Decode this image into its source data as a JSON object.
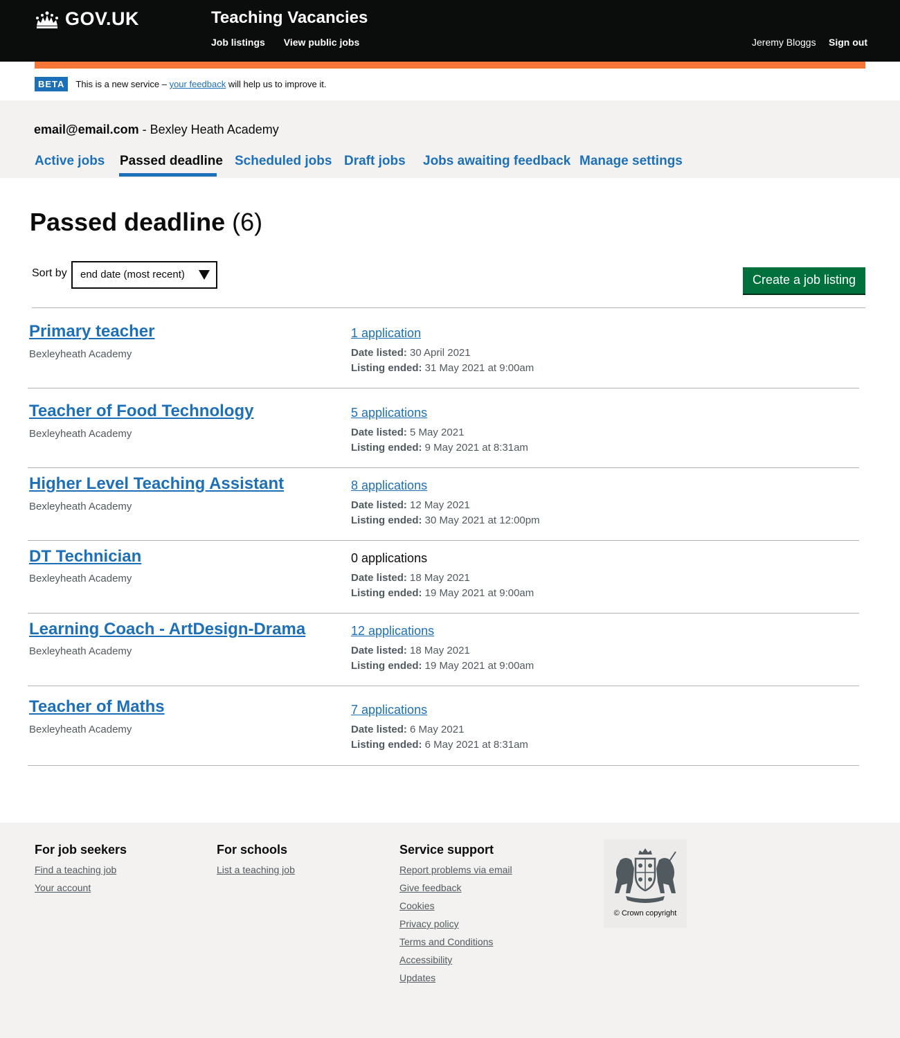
{
  "header": {
    "logo_text": "GOV.UK",
    "service_name": "Teaching Vacancies",
    "nav": [
      "Job listings",
      "View public jobs"
    ],
    "user_name": "Jeremy Bloggs",
    "sign_out": "Sign out"
  },
  "beta": {
    "tag": "BETA",
    "text_before": "This is a new service –",
    "link": "your feedback",
    "text_after": "will help us to improve it."
  },
  "account": {
    "email": "email@email.com",
    "school": "- Bexley Heath Academy"
  },
  "tabs": [
    {
      "label": "Active jobs",
      "active": false
    },
    {
      "label": "Passed deadline",
      "active": true
    },
    {
      "label": "Scheduled jobs",
      "active": false
    },
    {
      "label": "Draft jobs",
      "active": false
    },
    {
      "label": "Jobs awaiting feedback",
      "active": false
    },
    {
      "label": "Manage settings",
      "active": false
    }
  ],
  "page": {
    "title": "Passed deadline",
    "count": "(6)",
    "sort_label": "Sort by",
    "sort_value": "end date (most recent)",
    "create_button": "Create a job listing"
  },
  "jobs": [
    {
      "title": "Primary teacher",
      "school": "Bexleyheath Academy",
      "applications": "1 application",
      "applications_link": true,
      "date_listed_label": "Date listed:",
      "date_listed": "30 April 2021",
      "listing_ended_label": "Listing ended:",
      "listing_ended": "31 May 2021 at 9:00am"
    },
    {
      "title": "Teacher of Food Technology",
      "school": "Bexleyheath Academy",
      "applications": "5 applications",
      "applications_link": true,
      "date_listed_label": "Date listed:",
      "date_listed": "5 May 2021",
      "listing_ended_label": "Listing ended:",
      "listing_ended": "9 May 2021 at 8:31am"
    },
    {
      "title": "Higher Level Teaching Assistant",
      "school": "Bexleyheath Academy",
      "applications": "8 applications",
      "applications_link": true,
      "date_listed_label": "Date listed:",
      "date_listed": "12 May 2021",
      "listing_ended_label": "Listing ended:",
      "listing_ended": "30 May 2021 at 12:00pm"
    },
    {
      "title": "DT Technician",
      "school": "Bexleyheath Academy",
      "applications": "0 applications",
      "applications_link": false,
      "date_listed_label": "Date listed:",
      "date_listed": "18 May 2021",
      "listing_ended_label": "Listing ended:",
      "listing_ended": "19 May 2021 at 9:00am"
    },
    {
      "title": "Learning Coach - ArtDesign-Drama",
      "school": "Bexleyheath Academy",
      "applications": "12 applications",
      "applications_link": true,
      "date_listed_label": "Date listed:",
      "date_listed": "18 May 2021",
      "listing_ended_label": "Listing ended:",
      "listing_ended": "19 May 2021 at 9:00am"
    },
    {
      "title": "Teacher of Maths",
      "school": "Bexleyheath Academy",
      "applications": "7 applications",
      "applications_link": true,
      "date_listed_label": "Date listed:",
      "date_listed": "6 May 2021",
      "listing_ended_label": "Listing ended:",
      "listing_ended": "6 May 2021 at 8:31am"
    }
  ],
  "footer": {
    "columns": [
      {
        "heading": "For job seekers",
        "links": [
          "Find a teaching job",
          "Your account"
        ]
      },
      {
        "heading": "For schools",
        "links": [
          "List a teaching job"
        ]
      },
      {
        "heading": "Service support",
        "links": [
          "Report problems via email",
          "Give feedback",
          "Cookies",
          "Privacy policy",
          "Terms and Conditions",
          "Accessibility",
          "Updates"
        ]
      }
    ],
    "copyright": "© Crown copyright"
  },
  "colors": {
    "header_bg": "#0b0c0c",
    "link": "#1d70b8",
    "accent_bar": "#f47738",
    "button": "#00703c",
    "grey_band": "#f3f2f1"
  },
  "icons": [
    "crown-icon",
    "dropdown-arrow-icon",
    "royal-coat-of-arms-icon"
  ]
}
